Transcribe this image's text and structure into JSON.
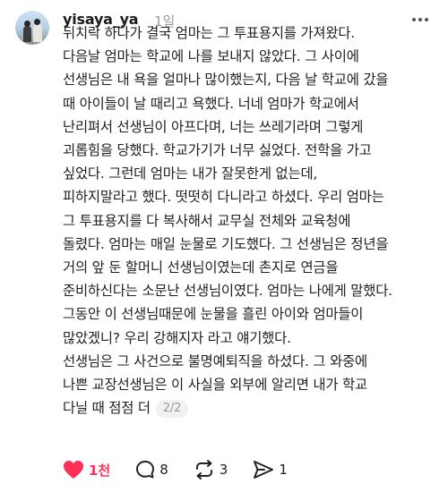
{
  "post": {
    "username": "yisaya_ya",
    "time": "1일",
    "lines": [
      "뒤치락 하다가 결국 엄마는 그 투표용지를 가져왔다.",
      "다음날 엄마는 학교에 나를 보내지 않았다.  그 사이에",
      "선생님은 내 욕을 얼마나 많이했는지, 다음 날 학교에 갔을",
      "때 아이들이 날 때리고 욕했다. 너네 엄마가 학교에서",
      "난리펴서 선생님이 아프다며, 너는 쓰레기라며 그렇게",
      "괴롭힘을 당했다. 학교가기가 너무 싫었다. 전학을 가고",
      "싶었다. 그런데 엄마는 내가 잘못한게 없는데,",
      "피하지말라고 했다. 떳떳히 다니라고 하셨다. 우리 엄마는",
      "그 투표용지를 다 복사해서 교무실 전체와 교육청에",
      "돌렸다. 엄마는 매일 눈물로 기도했다. 그 선생님은 정년을",
      "거의 앞 둔 할머니 선생님이였는데 촌지로 연금을",
      "준비하신다는 소문난 선생님이였다. 엄마는 나에게 말했다.",
      "그동안 이 선생님때문에 눈물을 흘린 아이와 엄마들이",
      "많았겠니? 우리 강해지자 라고 얘기했다.",
      "선생님은 그 사건으로 불명예퇴직을 하셨다. 그 와중에",
      "나쁜 교장선생님은 이 사실을 외부에 알리면 내가 학교",
      "다닐 때 점점 더"
    ],
    "page_indicator": "2/2"
  },
  "actions": {
    "likes": "1천",
    "comments": "8",
    "reposts": "3",
    "shares": "1"
  },
  "icons": {
    "avatar": "profile-photo",
    "more": "more-dots-icon",
    "like": "heart-icon",
    "comment": "comment-icon",
    "repost": "repost-icon",
    "share": "send-icon"
  },
  "colors": {
    "like": "#ff2f55",
    "muted": "#9a9a9a"
  }
}
